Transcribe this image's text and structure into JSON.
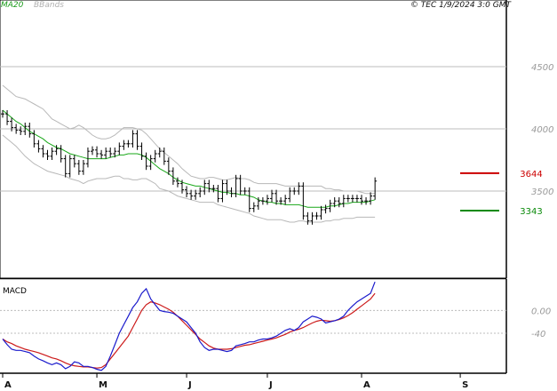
{
  "chart_data": {
    "type": "line",
    "header": {
      "legend_ma": "MA20",
      "legend_bb": "BBands",
      "copyright": "© TEC 1/9/2024 3:0 GMT"
    },
    "price_panel": {
      "y_ticks": [
        {
          "value": 4500,
          "label": "4500"
        },
        {
          "value": 4000,
          "label": "4000"
        },
        {
          "value": 3500,
          "label": "3500"
        }
      ],
      "ylim": [
        2800,
        4950
      ],
      "markers": [
        {
          "label": "3644",
          "value": 3644,
          "color": "#cc0000"
        },
        {
          "label": "3343",
          "value": 3343,
          "color": "#0a8a0a"
        }
      ],
      "ohlc_close": [
        4120,
        4060,
        4010,
        3990,
        3980,
        4020,
        3960,
        3880,
        3840,
        3800,
        3780,
        3820,
        3840,
        3760,
        3640,
        3760,
        3720,
        3660,
        3720,
        3820,
        3830,
        3800,
        3790,
        3820,
        3800,
        3820,
        3860,
        3880,
        3880,
        3960,
        3860,
        3780,
        3700,
        3760,
        3800,
        3820,
        3740,
        3660,
        3580,
        3560,
        3510,
        3480,
        3460,
        3480,
        3500,
        3560,
        3520,
        3520,
        3440,
        3560,
        3500,
        3480,
        3600,
        3500,
        3500,
        3360,
        3380,
        3420,
        3420,
        3440,
        3480,
        3420,
        3420,
        3440,
        3500,
        3500,
        3540,
        3300,
        3260,
        3300,
        3300,
        3350,
        3360,
        3400,
        3420,
        3400,
        3440,
        3440,
        3440,
        3440,
        3420,
        3420,
        3460,
        3580
      ],
      "ma20": [
        4150,
        4120,
        4090,
        4060,
        4040,
        4010,
        3980,
        3960,
        3940,
        3920,
        3890,
        3870,
        3850,
        3840,
        3820,
        3800,
        3790,
        3780,
        3770,
        3760,
        3760,
        3760,
        3760,
        3760,
        3770,
        3780,
        3790,
        3790,
        3800,
        3800,
        3800,
        3790,
        3770,
        3740,
        3710,
        3680,
        3660,
        3640,
        3610,
        3590,
        3570,
        3560,
        3550,
        3540,
        3540,
        3530,
        3520,
        3510,
        3500,
        3490,
        3490,
        3480,
        3480,
        3470,
        3470,
        3460,
        3450,
        3430,
        3420,
        3410,
        3410,
        3400,
        3400,
        3390,
        3390,
        3390,
        3390,
        3380,
        3370,
        3370,
        3370,
        3370,
        3370,
        3380,
        3380,
        3390,
        3400,
        3400,
        3410,
        3410,
        3410,
        3410,
        3420,
        3430
      ],
      "bb_upper": [
        4350,
        4320,
        4290,
        4260,
        4250,
        4240,
        4220,
        4200,
        4180,
        4160,
        4120,
        4080,
        4060,
        4040,
        4020,
        4000,
        4010,
        4030,
        4010,
        3980,
        3950,
        3930,
        3920,
        3920,
        3930,
        3950,
        3980,
        4010,
        4010,
        4010,
        4000,
        3990,
        3960,
        3920,
        3880,
        3840,
        3810,
        3780,
        3750,
        3720,
        3680,
        3650,
        3620,
        3610,
        3600,
        3600,
        3610,
        3610,
        3600,
        3590,
        3590,
        3600,
        3610,
        3600,
        3600,
        3590,
        3570,
        3560,
        3560,
        3560,
        3560,
        3560,
        3550,
        3540,
        3540,
        3540,
        3540,
        3540,
        3540,
        3540,
        3540,
        3540,
        3520,
        3520,
        3510,
        3510,
        3500,
        3500,
        3500,
        3500,
        3490,
        3480,
        3480,
        3480
      ],
      "bb_lower": [
        3950,
        3920,
        3890,
        3860,
        3820,
        3780,
        3750,
        3720,
        3700,
        3680,
        3660,
        3650,
        3640,
        3630,
        3620,
        3600,
        3590,
        3580,
        3560,
        3580,
        3590,
        3600,
        3600,
        3600,
        3610,
        3620,
        3620,
        3600,
        3600,
        3590,
        3590,
        3600,
        3600,
        3580,
        3560,
        3520,
        3510,
        3500,
        3480,
        3460,
        3450,
        3440,
        3430,
        3420,
        3410,
        3410,
        3410,
        3410,
        3390,
        3380,
        3370,
        3360,
        3350,
        3340,
        3330,
        3320,
        3300,
        3290,
        3280,
        3270,
        3270,
        3270,
        3270,
        3260,
        3250,
        3250,
        3260,
        3260,
        3250,
        3250,
        3250,
        3250,
        3260,
        3260,
        3270,
        3270,
        3280,
        3280,
        3280,
        3290,
        3290,
        3290,
        3290,
        3290
      ]
    },
    "macd_panel": {
      "label": "MACD",
      "y_ticks": [
        {
          "value": 0,
          "label": "0.00"
        },
        {
          "value": -40,
          "label": "-40"
        }
      ],
      "ylim": [
        -110,
        55
      ],
      "macd": [
        -50,
        -60,
        -68,
        -70,
        -70,
        -72,
        -74,
        -80,
        -85,
        -88,
        -92,
        -95,
        -92,
        -95,
        -102,
        -98,
        -90,
        -92,
        -98,
        -98,
        -100,
        -103,
        -105,
        -98,
        -80,
        -60,
        -40,
        -25,
        -10,
        5,
        15,
        30,
        38,
        20,
        10,
        0,
        -2,
        -3,
        -5,
        -10,
        -15,
        -20,
        -30,
        -40,
        -55,
        -65,
        -70,
        -68,
        -68,
        -70,
        -72,
        -70,
        -62,
        -60,
        -58,
        -55,
        -55,
        -52,
        -50,
        -50,
        -48,
        -45,
        -40,
        -35,
        -32,
        -35,
        -30,
        -20,
        -15,
        -10,
        -12,
        -15,
        -22,
        -20,
        -18,
        -15,
        -10,
        0,
        8,
        15,
        20,
        25,
        30,
        50
      ],
      "signal": [
        -50,
        -55,
        -58,
        -62,
        -65,
        -68,
        -70,
        -72,
        -74,
        -77,
        -80,
        -83,
        -85,
        -88,
        -92,
        -95,
        -97,
        -98,
        -99,
        -99,
        -100,
        -101,
        -100,
        -95,
        -85,
        -75,
        -65,
        -55,
        -45,
        -30,
        -15,
        0,
        10,
        15,
        13,
        10,
        6,
        2,
        -3,
        -10,
        -18,
        -26,
        -34,
        -42,
        -50,
        -56,
        -62,
        -66,
        -68,
        -68,
        -68,
        -67,
        -65,
        -63,
        -61,
        -60,
        -58,
        -56,
        -54,
        -52,
        -50,
        -48,
        -45,
        -42,
        -38,
        -35,
        -33,
        -30,
        -26,
        -22,
        -19,
        -17,
        -18,
        -19,
        -18,
        -16,
        -13,
        -9,
        -4,
        2,
        8,
        14,
        20,
        30
      ]
    },
    "x_axis": {
      "labels": [
        {
          "label": "A",
          "index": 0
        },
        {
          "label": "M",
          "index": 21
        },
        {
          "label": "J",
          "index": 41
        },
        {
          "label": "J",
          "index": 59
        },
        {
          "label": "A",
          "index": 80
        },
        {
          "label": "S",
          "index": 102
        }
      ],
      "total_slots": 104
    },
    "colors": {
      "ma": "#1aa81a",
      "bb": "#b8b8b8",
      "price": "#000000",
      "macd": "#1a1acc",
      "signal": "#cc1a1a",
      "grid": "#bcbcbc"
    }
  }
}
